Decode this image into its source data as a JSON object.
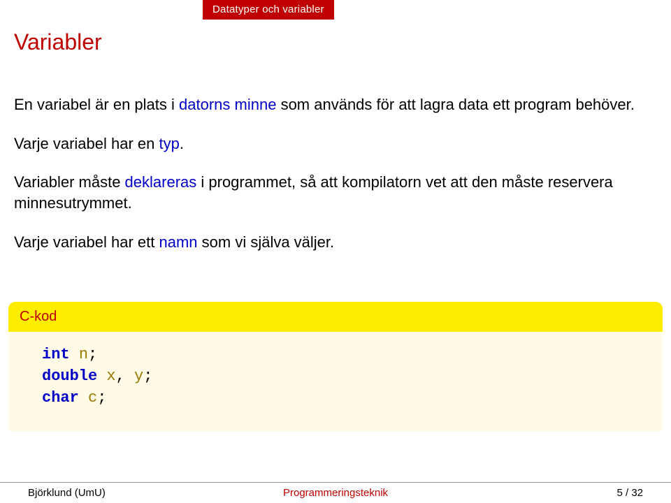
{
  "section_tab": "Datatyper och variabler",
  "title": "Variabler",
  "para1": {
    "t1": "En variabel är en plats i ",
    "term": "datorns minne",
    "t2": " som används för att lagra data ett program behöver."
  },
  "para2": {
    "t1": "Varje variabel har en ",
    "term": "typ",
    "t2": "."
  },
  "para3": {
    "t1": "Variabler måste ",
    "term": "deklareras",
    "t2": " i programmet, så att kompilatorn vet att den måste reservera minnesutrymmet."
  },
  "para4": {
    "t1": "Varje variabel har ett ",
    "term": "namn",
    "t2": " som vi själva väljer."
  },
  "codebox": {
    "title": "C-kod",
    "lines": {
      "l1_kw": "int",
      "l1_var": "n",
      "l2_kw": "double",
      "l2_var1": "x",
      "l2_var2": "y",
      "l3_kw": "char",
      "l3_var": "c"
    }
  },
  "footer": {
    "left": "Björklund (UmU)",
    "center": "Programmeringsteknik",
    "right": "5 / 32"
  }
}
